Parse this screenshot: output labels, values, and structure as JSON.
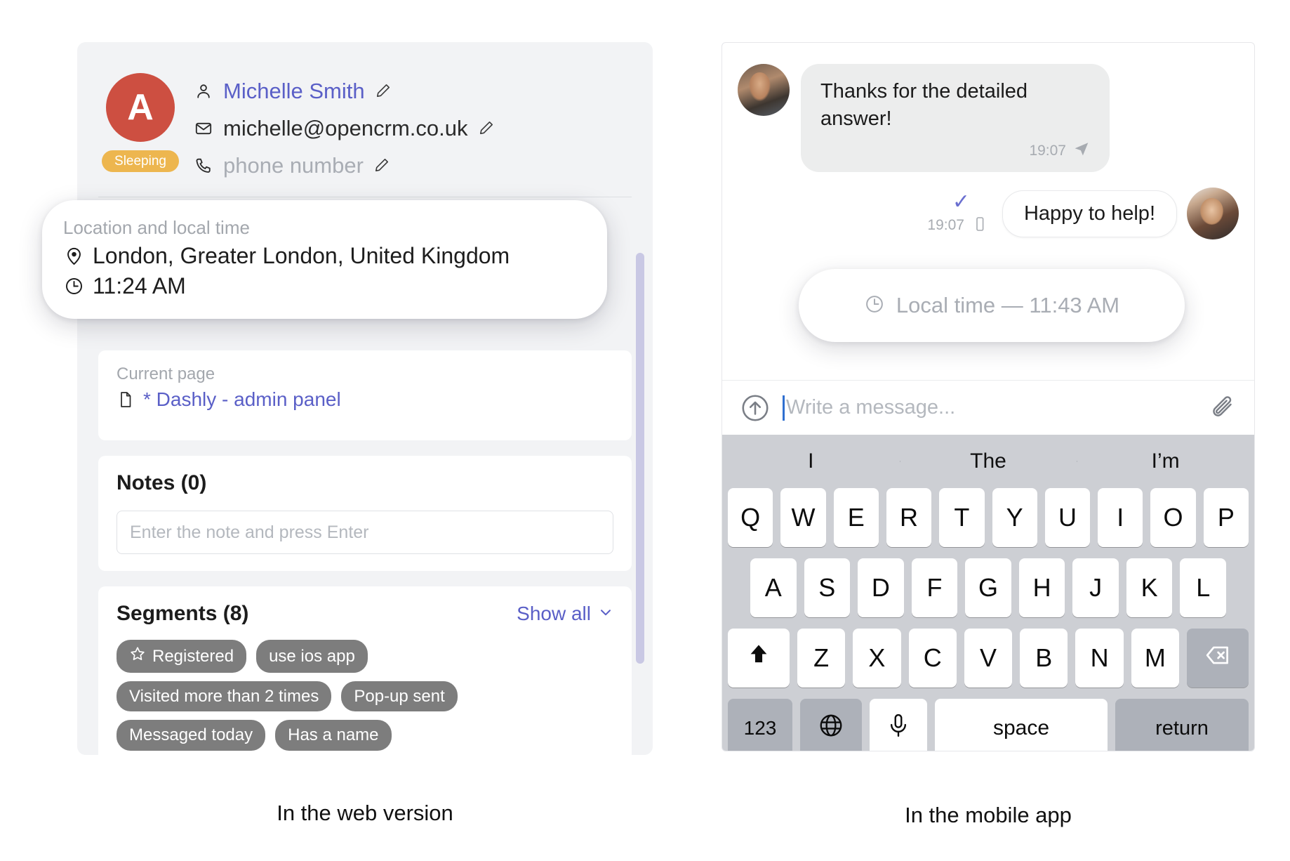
{
  "web": {
    "contact": {
      "avatar_letter": "A",
      "avatar_color": "#cd4f41",
      "status_badge": "Sleeping",
      "status_badge_color": "#edb64f",
      "name": "Michelle Smith",
      "email": "michelle@opencrm.co.uk",
      "phone_placeholder": "phone number"
    },
    "location_tooltip": {
      "label": "Location and local time",
      "place": "London, Greater London, United Kingdom",
      "time": "11:24 AM"
    },
    "current_page": {
      "label": "Current page",
      "title": "* Dashly - admin panel"
    },
    "notes": {
      "title": "Notes (0)",
      "input_value": "",
      "input_placeholder": "Enter the note and press Enter"
    },
    "segments": {
      "title": "Segments (8)",
      "show_all": "Show all",
      "chips": [
        {
          "label": "Registered",
          "icon": "star-icon"
        },
        {
          "label": "use ios app",
          "icon": ""
        },
        {
          "label": "Visited more than 2 times",
          "icon": ""
        },
        {
          "label": "Pop-up sent",
          "icon": ""
        },
        {
          "label": "Messaged today",
          "icon": ""
        },
        {
          "label": "Has a name",
          "icon": ""
        }
      ]
    },
    "caption": "In the web version"
  },
  "mobile": {
    "messages": [
      {
        "direction": "incoming",
        "text": "Thanks for the detailed answer!",
        "time": "19:07",
        "status_icon": "send-icon"
      },
      {
        "direction": "outgoing",
        "text": "Happy to help!",
        "time": "19:07",
        "status_icon": "phone-icon",
        "read_icon": "check-icon"
      }
    ],
    "local_time_pill": {
      "text": "Local time — 11:43 AM"
    },
    "composer": {
      "input_value": "",
      "placeholder": "Write a message..."
    },
    "keyboard": {
      "suggestions": [
        "I",
        "The",
        "I’m"
      ],
      "row1": [
        "Q",
        "W",
        "E",
        "R",
        "T",
        "Y",
        "U",
        "I",
        "O",
        "P"
      ],
      "row2": [
        "A",
        "S",
        "D",
        "F",
        "G",
        "H",
        "J",
        "K",
        "L"
      ],
      "row3_letters": [
        "Z",
        "X",
        "C",
        "V",
        "B",
        "N",
        "M"
      ],
      "shift_key": "shift-icon",
      "backspace_key": "backspace-icon",
      "numbers_key": "123",
      "globe_key": "globe-icon",
      "mic_key": "microphone-icon",
      "space_key": "space",
      "return_key": "return"
    },
    "caption": "In the mobile app"
  }
}
